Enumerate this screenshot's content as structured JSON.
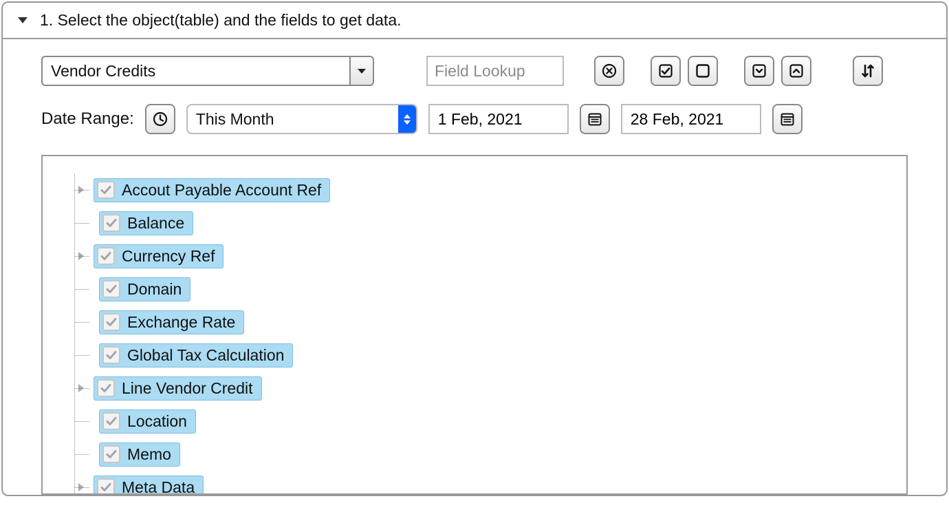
{
  "header": {
    "title": "1. Select the object(table) and the fields to get data."
  },
  "object_select": {
    "value": "Vendor Credits"
  },
  "field_lookup": {
    "placeholder": "Field Lookup",
    "value": ""
  },
  "icons": {
    "clear": "clear-icon",
    "check_all": "check-all-icon",
    "uncheck_all": "uncheck-all-icon",
    "expand_all": "expand-all-icon",
    "collapse_all": "collapse-all-icon",
    "sort": "sort-icon",
    "clock": "clock-icon",
    "cal1": "calendar-icon",
    "cal2": "calendar-icon"
  },
  "date_range": {
    "label": "Date Range:",
    "preset": "This Month",
    "start": "1 Feb, 2021",
    "end": "28 Feb, 2021"
  },
  "tree": {
    "items": [
      {
        "label": "Accout Payable Account Ref",
        "checked": true,
        "expandable": true
      },
      {
        "label": "Balance",
        "checked": true,
        "expandable": false
      },
      {
        "label": "Currency Ref",
        "checked": true,
        "expandable": true
      },
      {
        "label": "Domain",
        "checked": true,
        "expandable": false
      },
      {
        "label": "Exchange Rate",
        "checked": true,
        "expandable": false
      },
      {
        "label": "Global Tax Calculation",
        "checked": true,
        "expandable": false
      },
      {
        "label": "Line Vendor Credit",
        "checked": true,
        "expandable": true
      },
      {
        "label": "Location",
        "checked": true,
        "expandable": false
      },
      {
        "label": "Memo",
        "checked": true,
        "expandable": false
      },
      {
        "label": "Meta Data",
        "checked": true,
        "expandable": true
      }
    ]
  }
}
